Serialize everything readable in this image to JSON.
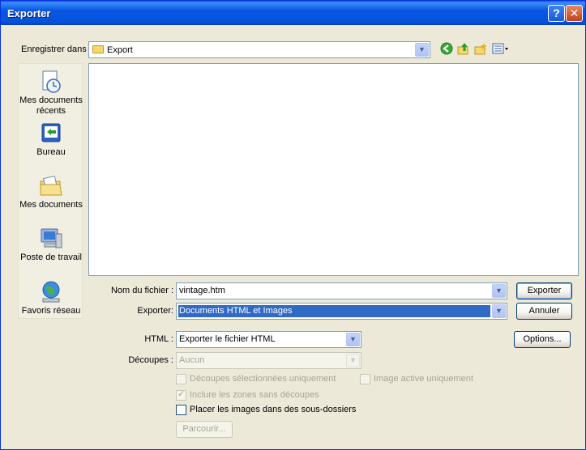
{
  "window": {
    "title": "Exporter"
  },
  "save_in": {
    "label": "Enregistrer dans :",
    "value": "Export"
  },
  "places": [
    {
      "label": "Mes documents récents",
      "icon": "recent-documents-icon"
    },
    {
      "label": "Bureau",
      "icon": "desktop-icon"
    },
    {
      "label": "Mes documents",
      "icon": "my-documents-icon"
    },
    {
      "label": "Poste de travail",
      "icon": "my-computer-icon"
    },
    {
      "label": "Favoris réseau",
      "icon": "network-places-icon"
    }
  ],
  "filename": {
    "label": "Nom du fichier :",
    "value": "vintage.htm"
  },
  "export_type": {
    "label": "Exporter:",
    "value": "Documents HTML et Images"
  },
  "html": {
    "label": "HTML :",
    "value": "Exporter le fichier HTML"
  },
  "slices": {
    "label": "Découpes :",
    "value": "Aucun"
  },
  "options": {
    "selected_slices_only": {
      "label": "Découpes sélectionnées uniquement",
      "checked": false
    },
    "active_image_only": {
      "label": "Image active uniquement",
      "checked": false
    },
    "include_empty_zones": {
      "label": "Inclure les zones sans découpes",
      "checked": true
    },
    "images_in_subfolders": {
      "label": "Placer les images dans des sous-dossiers",
      "checked": false
    }
  },
  "buttons": {
    "export": "Exporter",
    "cancel": "Annuler",
    "options": "Options...",
    "browse": "Parcourir..."
  },
  "title_buttons": {
    "help": "?",
    "close": "✕"
  },
  "colors": {
    "titlebar": "#0652dd",
    "dialog_bg": "#ece9d8",
    "selection": "#316ac5"
  }
}
